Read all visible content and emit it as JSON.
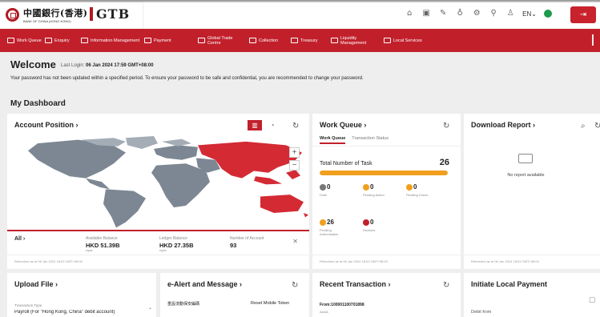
{
  "brand": {
    "bank_name_cn": "中國銀行(香港)",
    "bank_name_en": "BANK OF CHINA (HONG KONG)",
    "product": "GTB"
  },
  "topbar": {
    "icons": [
      "home-icon",
      "inbox-icon",
      "edit-icon",
      "bell-icon",
      "settings-icon",
      "location-icon",
      "user-icon"
    ],
    "language": "EN",
    "status_icon": "status-icon",
    "logout_icon": "logout-icon"
  },
  "nav": {
    "items": [
      {
        "label": "Work Queue",
        "icon": "queue-icon"
      },
      {
        "label": "Enquiry",
        "icon": "enquiry-icon"
      },
      {
        "label": "Information Management",
        "icon": "folder-icon"
      },
      {
        "label": "Payment",
        "icon": "payment-icon"
      },
      {
        "label": "Global Trade Centre",
        "icon": "globe-icon"
      },
      {
        "label": "Collection",
        "icon": "collection-icon"
      },
      {
        "label": "Treasury",
        "icon": "treasury-icon"
      },
      {
        "label": "Liquidity Management",
        "icon": "liquidity-icon"
      },
      {
        "label": "Local Services",
        "icon": "local-services-icon"
      }
    ]
  },
  "welcome": {
    "title": "Welcome",
    "last_login_label": "Last Login:",
    "last_login_value": "06 Jan 2024 17:59 GMT+08:00",
    "password_message": "Your password has not been updated within a specified period. To ensure your password to be safe and confidential, you are recommended to change your password."
  },
  "dashboard_title": "My Dashboard",
  "account_position": {
    "title": "Account Position",
    "account_selector": "All",
    "available_label": "Available Balance",
    "available_value": "HKD 51.39B",
    "available_sub": "equiv.",
    "ledger_label": "Ledger Balance",
    "ledger_value": "HKD 27.35B",
    "ledger_sub": "equiv.",
    "count_label": "Number of Account",
    "count_value": "93",
    "refreshed": "Refreshed as at 06 Jan 2024 18:03 GMT+08:00",
    "zoom_in": "+",
    "zoom_out": "−",
    "highlight_color": "#d42a34"
  },
  "work_queue": {
    "title": "Work Queue",
    "tabs": [
      "Work Queue",
      "Transaction Status"
    ],
    "total_label": "Total Number of Task",
    "total_value": "26",
    "progress_fraction": 1.0,
    "stats": [
      {
        "value": "0",
        "label": "Draft",
        "color": "#777777"
      },
      {
        "value": "0",
        "label": "Pending Action",
        "color": "#f0a01e"
      },
      {
        "value": "0",
        "label": "Pending Check",
        "color": "#f0a01e"
      },
      {
        "value": "26",
        "label": "Pending Authorisation",
        "color": "#f0a01e"
      },
      {
        "value": "0",
        "label": "Declines",
        "color": "#c1202b"
      }
    ],
    "refreshed": "Refreshed as at 06 Jan 2024 18:03 GMT+08:00"
  },
  "download_report": {
    "title": "Download Report",
    "empty_text": "No report available",
    "refreshed": "Refreshed as at 06 Jan 2024 18:03 GMT+08:00"
  },
  "upload_file": {
    "title": "Upload File",
    "field_label": "Transaction Type",
    "field_value": "Payroll (For \"Hong Kong, China\" debit account)"
  },
  "ealert": {
    "title": "e-Alert and Message",
    "item_label": "重設流動保安編碼",
    "item_action": "Reset Mobile Token"
  },
  "recent_transaction": {
    "title": "Recent Transaction",
    "from_text": "From:100001100701898",
    "sub_text": "AAAA"
  },
  "local_payment": {
    "title": "Initiate Local Payment",
    "debit_label": "Debit from"
  }
}
